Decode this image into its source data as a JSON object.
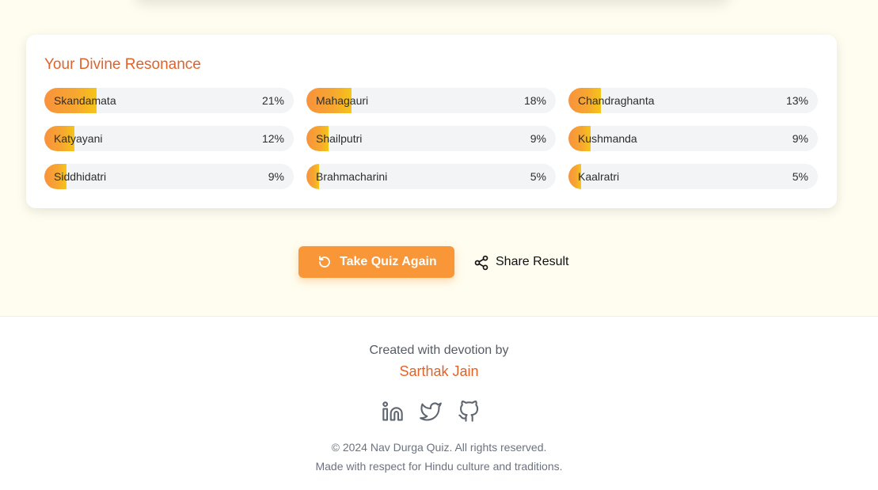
{
  "resonance": {
    "title": "Your Divine Resonance",
    "items": [
      {
        "name": "Skandamata",
        "percent_label": "21%",
        "value": 21
      },
      {
        "name": "Mahagauri",
        "percent_label": "18%",
        "value": 18
      },
      {
        "name": "Chandraghanta",
        "percent_label": "13%",
        "value": 13
      },
      {
        "name": "Katyayani",
        "percent_label": "12%",
        "value": 12
      },
      {
        "name": "Shailputri",
        "percent_label": "9%",
        "value": 9
      },
      {
        "name": "Kushmanda",
        "percent_label": "9%",
        "value": 9
      },
      {
        "name": "Siddhidatri",
        "percent_label": "9%",
        "value": 9
      },
      {
        "name": "Brahmacharini",
        "percent_label": "5%",
        "value": 5
      },
      {
        "name": "Kaalratri",
        "percent_label": "5%",
        "value": 5
      }
    ]
  },
  "actions": {
    "retake_label": "Take Quiz Again",
    "retake_icon": "refresh-icon",
    "share_label": "Share Result",
    "share_icon": "share-icon"
  },
  "footer": {
    "created_text": "Created with devotion by",
    "author": "Sarthak Jain",
    "socials": [
      "linkedin-icon",
      "twitter-icon",
      "github-icon"
    ],
    "copyright": "© 2024 Nav Durga Quiz. All rights reserved.",
    "tagline": "Made with respect for Hindu culture and traditions."
  },
  "colors": {
    "accent": "#e2632a",
    "button": "#f99637",
    "bar_start": "#f9923d",
    "bar_end": "#f5c518"
  }
}
